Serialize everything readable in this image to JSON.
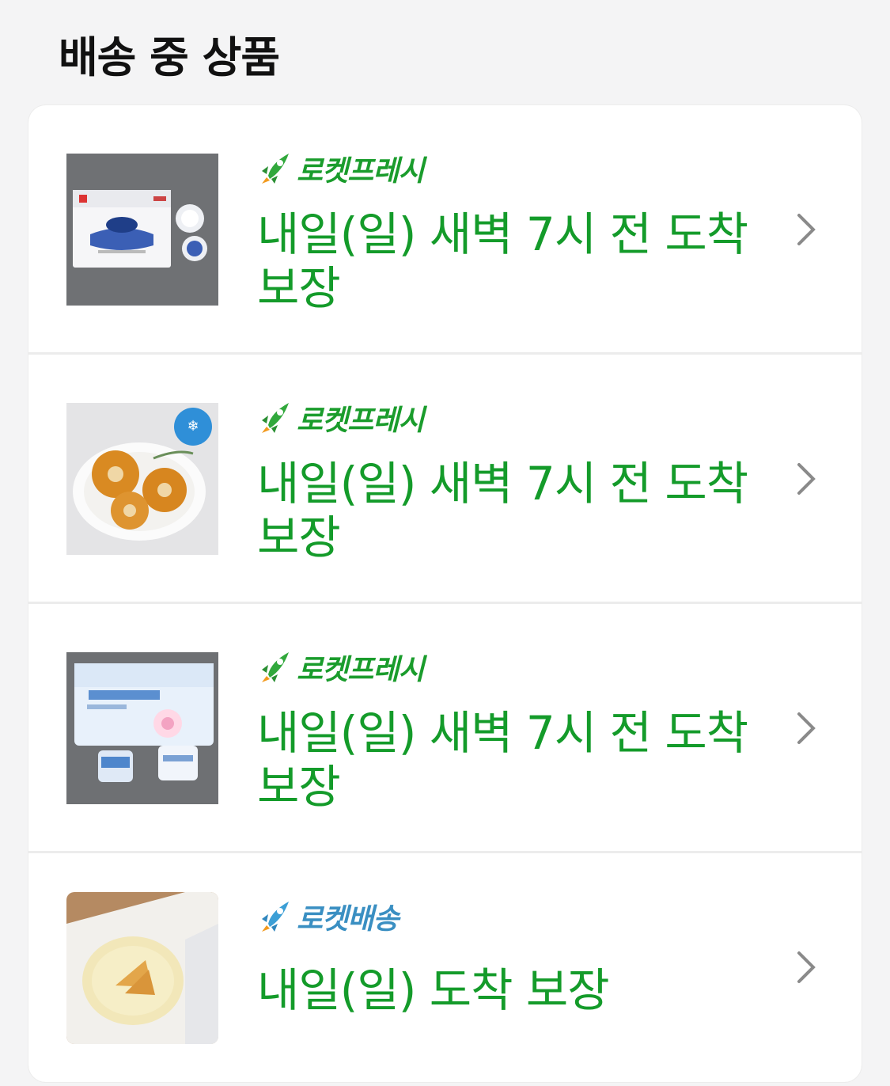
{
  "page": {
    "section_title": "배송 중 상품"
  },
  "items": [
    {
      "badge": "로켓프레시",
      "badge_type": "rocket-fresh",
      "eta": "내일(일) 새벽 7시 전 도착 보장",
      "thumbnail": "cream-cheese-box"
    },
    {
      "badge": "로켓프레시",
      "badge_type": "rocket-fresh",
      "eta": "내일(일) 새벽 7시 전 도착 보장",
      "thumbnail": "frozen-hash-brown-plate",
      "thumbnail_badge": "냉동"
    },
    {
      "badge": "로켓프레시",
      "badge_type": "rocket-fresh",
      "eta": "내일(일) 새벽 7시 전 도착 보장",
      "thumbnail": "fresh-cream-yogurt-pack"
    },
    {
      "badge": "로켓배송",
      "badge_type": "rocket-delivery",
      "eta": "내일(일) 도착 보장",
      "thumbnail": "toast-plate"
    }
  ],
  "colors": {
    "fresh_green": "#149b2a",
    "delivery_blue": "#3a8fc2",
    "page_bg": "#f4f4f5"
  }
}
